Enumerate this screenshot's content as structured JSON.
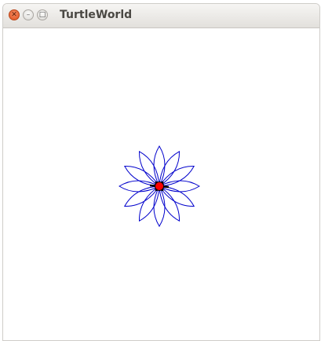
{
  "window": {
    "title": "TurtleWorld",
    "controls": {
      "close_icon": "close-icon",
      "minimize_icon": "minimize-icon",
      "maximize_icon": "maximize-icon",
      "close_glyph": "✕",
      "minimize_glyph": "–",
      "maximize_glyph": "□"
    }
  },
  "canvas": {
    "flower": {
      "petals": 12,
      "stroke_color": "#0000cc"
    },
    "turtle": {
      "fill_color": "#ff0000",
      "outline_color": "#000000"
    }
  }
}
